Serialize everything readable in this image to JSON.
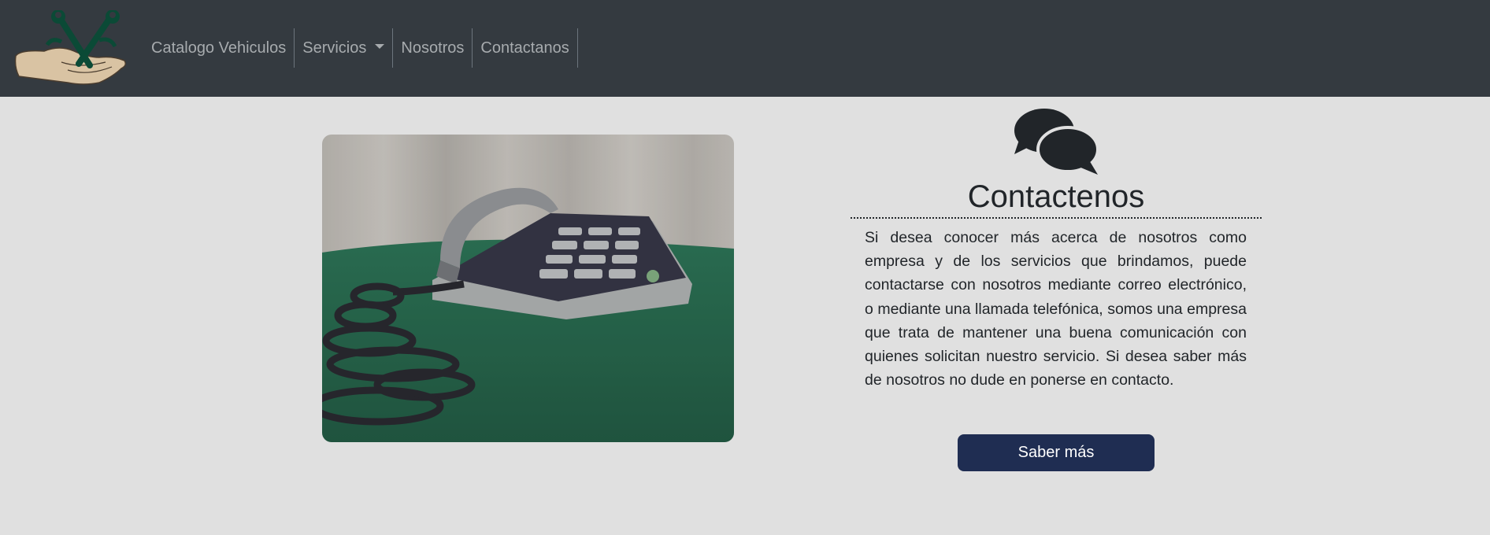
{
  "navbar": {
    "logo_icon": "hand-holding-wrenches-logo",
    "items": [
      {
        "label": "Catalogo Vehiculos"
      },
      {
        "label": "Servicios",
        "has_dropdown": true
      },
      {
        "label": "Nosotros"
      },
      {
        "label": "Contactanos"
      }
    ]
  },
  "contact": {
    "image_icon": "desk-telephone-photo",
    "header_icon": "comments-icon",
    "title": "Contactenos",
    "description": "Si desea conocer más acerca de nosotros como empresa y de los servicios que brindamos, puede contactarse con nosotros mediante correo electrónico, o mediante una llamada telefónica, somos una empresa que trata de mantener una buena comunicación con quienes solicitan nuestro servicio. Si desea saber más de nosotros no dude en ponerse en contacto.",
    "button_label": "Saber más"
  },
  "colors": {
    "navbar_bg": "#343a40",
    "page_bg": "#e0e0e0",
    "nav_text": "#a7abae",
    "button_bg": "#1f2d52",
    "text": "#212529"
  }
}
